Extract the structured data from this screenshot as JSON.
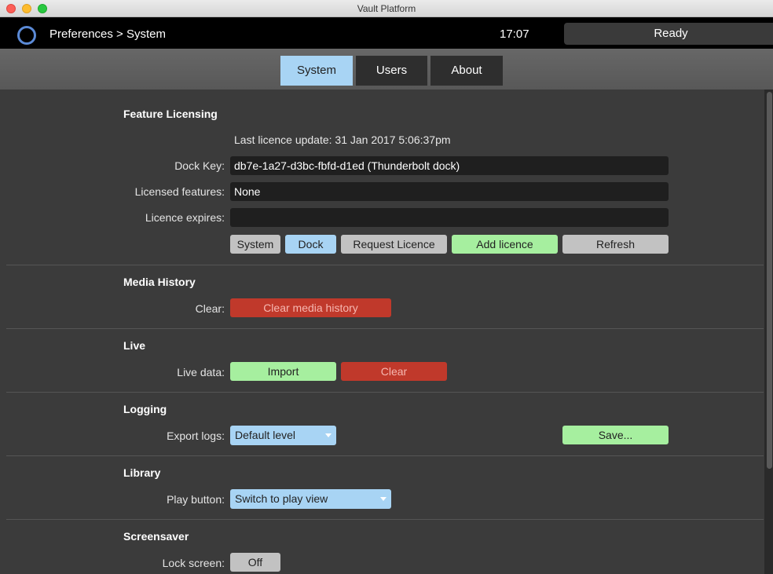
{
  "window": {
    "title": "Vault Platform"
  },
  "header": {
    "breadcrumb": "Preferences > System",
    "clock": "17:07",
    "status": "Ready"
  },
  "tabs": [
    {
      "label": "System",
      "active": true
    },
    {
      "label": "Users",
      "active": false
    },
    {
      "label": "About",
      "active": false
    }
  ],
  "licensing": {
    "title": "Feature Licensing",
    "last_update": "Last licence update: 31 Jan 2017 5:06:37pm",
    "dock_key_label": "Dock Key:",
    "dock_key_value": "db7e-1a27-d3bc-fbfd-d1ed (Thunderbolt dock)",
    "features_label": "Licensed features:",
    "features_value": "None",
    "expires_label": "Licence expires:",
    "expires_value": "",
    "btn_system": "System",
    "btn_dock": "Dock",
    "btn_request": "Request Licence",
    "btn_add": "Add licence",
    "btn_refresh": "Refresh"
  },
  "media_history": {
    "title": "Media History",
    "clear_label": "Clear:",
    "clear_button": "Clear media history"
  },
  "live": {
    "title": "Live",
    "data_label": "Live data:",
    "import_button": "Import",
    "clear_button": "Clear"
  },
  "logging": {
    "title": "Logging",
    "export_label": "Export logs:",
    "level_selected": "Default level",
    "save_button": "Save..."
  },
  "library": {
    "title": "Library",
    "play_label": "Play button:",
    "play_selected": "Switch to play view"
  },
  "screensaver": {
    "title": "Screensaver",
    "lock_label": "Lock screen:",
    "lock_value": "Off"
  },
  "colors": {
    "accent_blue": "#a8d4f4",
    "accent_green": "#a6ef9f",
    "danger_red": "#c0392b",
    "background": "#3b3b3b",
    "logo_ring": "#5b8ad6"
  },
  "icons": [
    "circle-logo-icon",
    "chevron-down-icon"
  ]
}
